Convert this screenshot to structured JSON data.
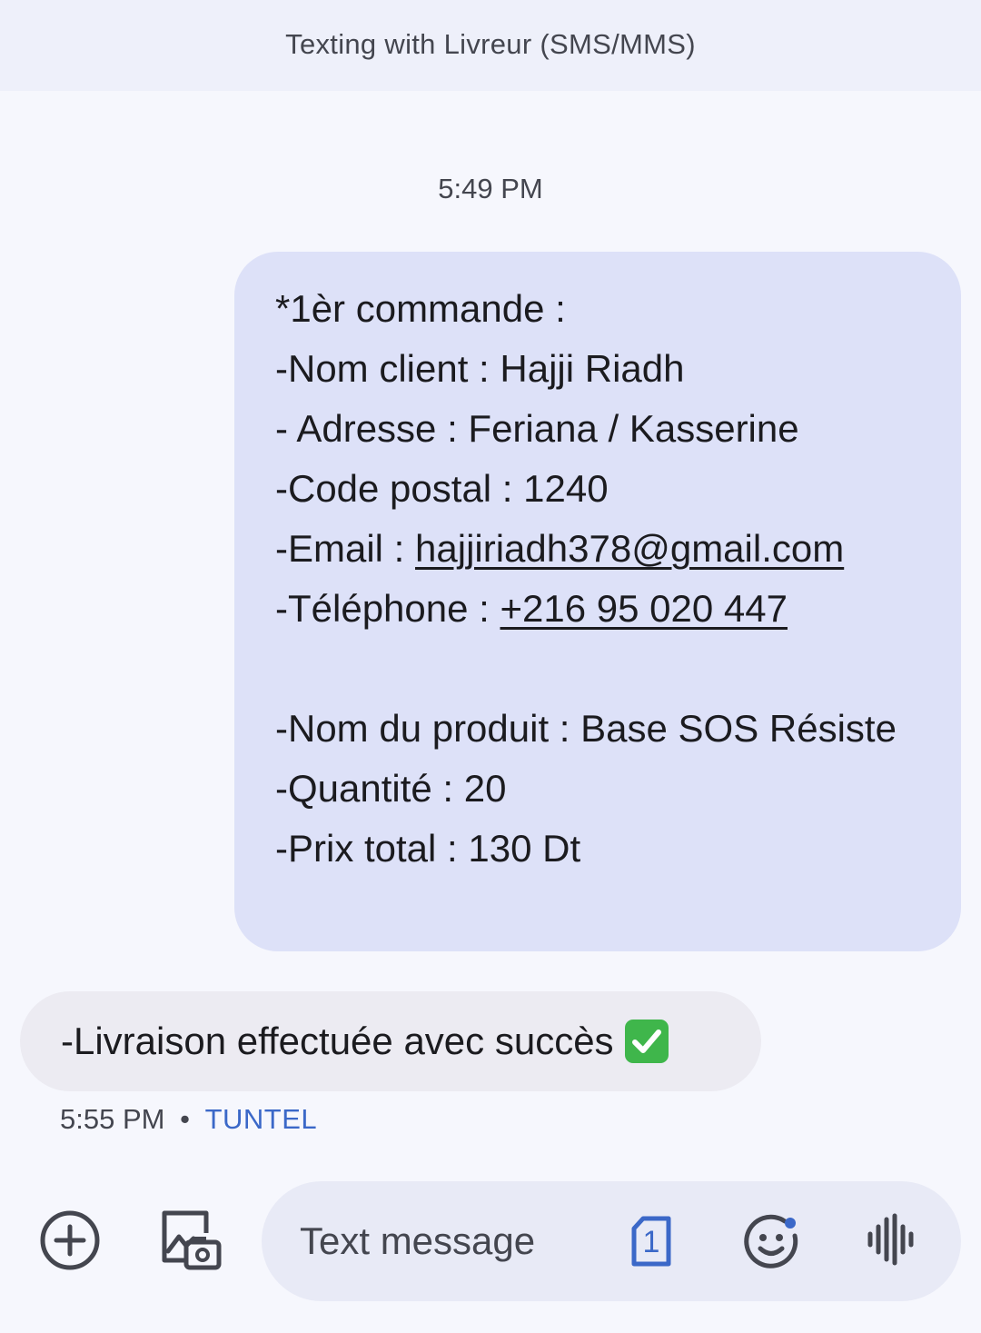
{
  "header": {
    "title": "Texting with Livreur (SMS/MMS)"
  },
  "conversation": {
    "timestamp": "5:49 PM",
    "sent_message": {
      "lines": [
        "*1èr commande :",
        "-Nom client : Hajji Riadh",
        "- Adresse : Feriana / Kasserine",
        "-Code postal : 1240"
      ],
      "email_label": "-Email : ",
      "email": "hajjiriadh378@gmail.com",
      "phone_label": "-Téléphone : ",
      "phone": "+216 95 020 447",
      "product_lines": [
        "-Nom du produit : Base SOS Résiste",
        "-Quantité : 20",
        "-Prix total : 130 Dt"
      ]
    },
    "received_message": {
      "text": "-Livraison effectuée avec succès",
      "emoji_icon": "white-check-mark-icon",
      "time": "5:55 PM",
      "separator": "•",
      "carrier": "TUNTEL"
    }
  },
  "composer": {
    "placeholder": "Text message",
    "sim_number": "1",
    "icons": {
      "add": "plus-circle-icon",
      "gallery": "gallery-camera-icon",
      "sim": "sim-card-icon",
      "emoji": "emoji-icon",
      "voice": "voice-waveform-icon"
    }
  },
  "colors": {
    "background": "#f6f7fd",
    "header_bg": "#eef0fa",
    "sent_bubble": "#dde1f8",
    "received_bubble": "#ecebf2",
    "accent": "#3b68c8",
    "compose_bg": "#e8eaf6"
  }
}
